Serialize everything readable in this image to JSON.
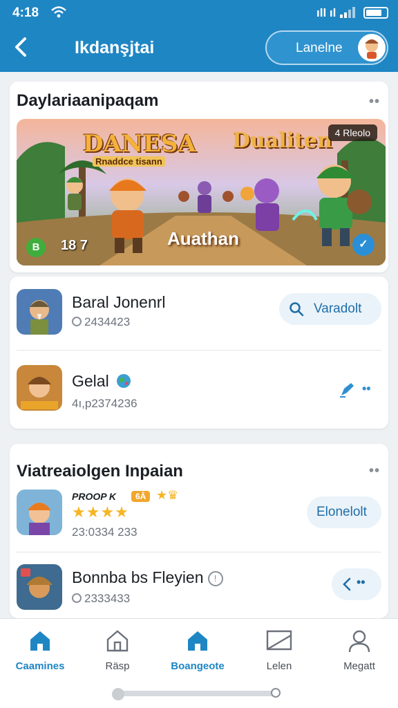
{
  "status": {
    "time": "4:18",
    "signal_text": "ıll ıl"
  },
  "header": {
    "title": "Ikdanşjtai",
    "action_label": "Lanelne"
  },
  "featured": {
    "title": "Daylariaanipaqam",
    "banner": {
      "logo_left": "DANESA",
      "logo_left_sub": "Rnaddce tisann",
      "logo_right": "Dualiten",
      "badge_top": "4 Rleolo",
      "badge_left": "B",
      "count": "18 7",
      "caption": "Auathan"
    }
  },
  "apps": [
    {
      "name": "Baral Jonenrl",
      "meta": "2434423",
      "button": "Varadolt"
    },
    {
      "name": "Gelal",
      "meta": "4ı,p2374236"
    }
  ],
  "section2": {
    "title": "Viatreaiolgen Inpaian",
    "items": [
      {
        "name": "PROOP K",
        "tag": "6Â",
        "rating": 4,
        "meta": "23:0334 233",
        "button": "Elonelolt"
      },
      {
        "name": "Bonnba bs Fleyien",
        "meta": "2333433"
      }
    ]
  },
  "nav": [
    {
      "label": "Caamines",
      "icon": "home-filled-icon"
    },
    {
      "label": "Räsp",
      "icon": "home-outline-icon"
    },
    {
      "label": "Boangeote",
      "icon": "home-active-icon"
    },
    {
      "label": "Lelen",
      "icon": "screen-icon"
    },
    {
      "label": "Megatt",
      "icon": "profile-icon"
    }
  ],
  "colors": {
    "header": "#1f86c4",
    "accent": "#1f86c4",
    "star": "#f5b524"
  }
}
